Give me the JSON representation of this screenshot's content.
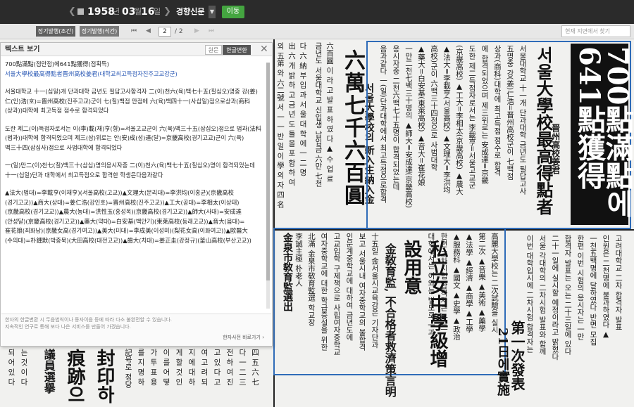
{
  "nav": {
    "year": "1958",
    "month": "03",
    "day": "16",
    "unit_year": "년",
    "unit_month": "월",
    "unit_day": "일",
    "paper": "경향신문",
    "go_label": "이동",
    "prev_icon": "chevron-left-icon",
    "next_icon": "chevron-right-icon"
  },
  "toolbar": {
    "btn_a": "정기발행(조간)",
    "btn_b": "정기발행(석간)",
    "page_current": "2",
    "page_total": "/ 2",
    "search_placeholder": "현재 지면에서 찾기"
  },
  "panel": {
    "title": "텍스트 보기",
    "tab_original": "원문",
    "tab_hangul": "한글변환",
    "footer_line1": "한자의 한글변환 시 두음법칙이나 동자이음 등에 따라 다소 불완전할 수 있습니다.",
    "footer_line2": "지속적인 연구로 통해 보다 나은 서비스를 만들어 가겠습니다.",
    "footer_link": "한자사전 바로가기 ›",
    "paragraphs": [
      "700點滿點(점만점)에641點獲得(점획득)",
      "서울大學校最高得點者晋州高校姜君(대학교최고득점자진주고교강군)",
      "서울대학교 十一(십일)개 단과대학 금년도 필답고사합격자 二(이)천六(육)백七十五(칠십오)명중 강(姜)仁(인)浩(호)=晋州高校(진주고교)군이 七(칠)백점 만점에 六(육)백四十一(사십일)점으로상과(商科(상과))대학에 최고득점 점수로 합격되었다",
      "도한 제二(이)득점자로서는 이(李)載(재)亨(형)=서울고교군이 六(육)백三十五(삼십오)점으로 법과(法科(법과))대학에 합격되었으며 제三(삼)위로는 안(安)成(성)達(달)=京畿高校(경기고교)군이 六(육)백三十四(삼십사)점으로 사범대학에 합격되었다",
      "一(일)만二(이)천七(칠)백三十(삼십)명의응시자중 二(이)천六(육)백七十五(칠십오)명이 합격되었는데 十一(십일)단과 대학에서 최고득점으로 합격한 학생은다음과같다",
      "▲法大(법대)=李載亨(이재亨)(서울高校(고교))▲文理大(문리대)=李洪均(이홍균)(京畿高校(경기고교))▲商大(상대)=姜仁浩(강인호)=晋州高校(진주고교))▲工大(공대)=李相太(이상태)(京畿高校(경기고교))▲農大(농대)=洪性玉(홍성옥)(京畿高校(경기고교))▲師大(사대)=安成達(안성달)(京畿高校(경기고교))▲藥大(약대)=白安基(백안기)(東萊高校(동래고교))▲音大(음대)=崔花娘(최화낭)(京畿女高(경기여고))▲美大(미대)=李成美(이성미)(梨花女高(이화여고))▲歐醫大(수의대)=朴鍾默(박종묵)(大田高校(대전고교))▲齒大(치대)=姜正圭(강정규)(釜山高校(부산고교))"
    ]
  },
  "newspaper": {
    "headline_main": "700點滿點에641點獲得",
    "headline_sub": "서울大學校最高得點者",
    "headline_name": "晋州高校姜君",
    "headline_center": "六萬七千六百圓",
    "headline_center_sub": "서울大學校의 新入生納入金",
    "headline_lower": "私立女中學級增設用意",
    "headline_lower_sub": "金敎育監, 不合格者救濟策言明",
    "headline_exam": "第一次發表",
    "headline_exam_date": "21日에實施",
    "headline_bottom_left": "封印하",
    "headline_bottom_left2": "痕跡으"
  }
}
